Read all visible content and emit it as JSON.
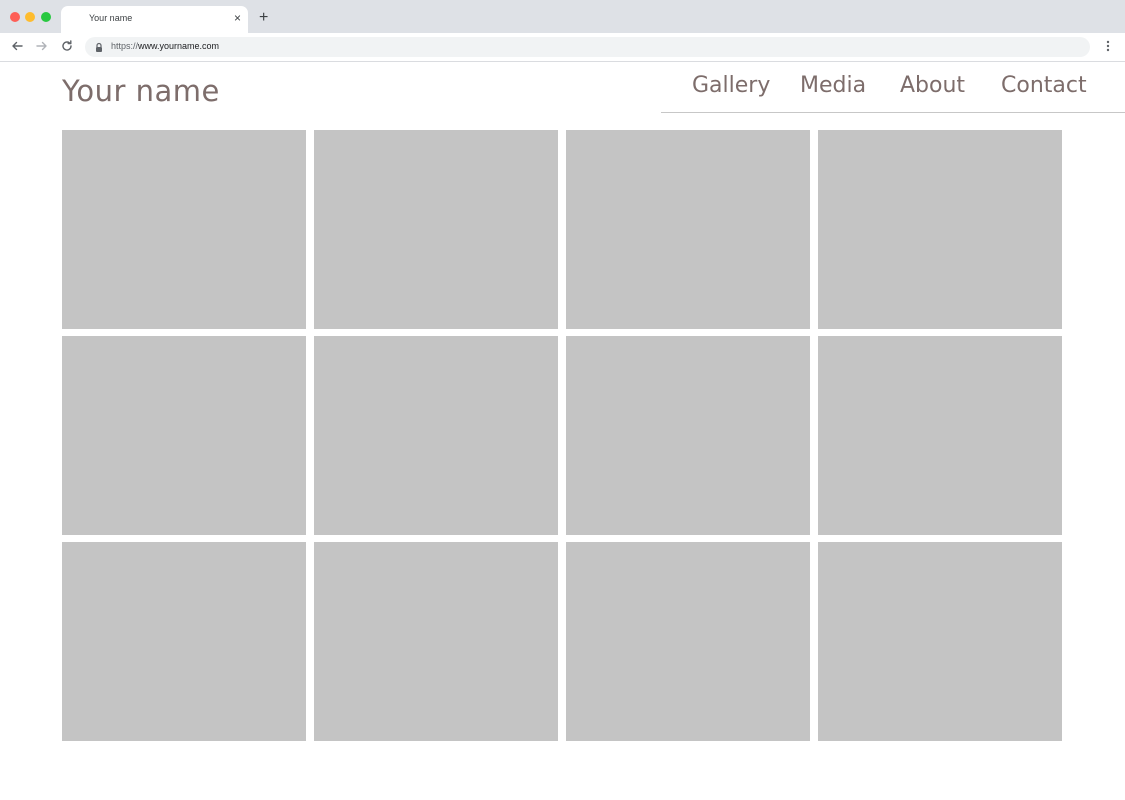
{
  "browser": {
    "tab_title": "Your name",
    "tab_close": "×",
    "new_tab": "+",
    "url_scheme": "https://",
    "url_host": "www.yourname.com"
  },
  "site": {
    "name": "Your name",
    "nav": {
      "gallery": "Gallery",
      "media": "Media",
      "about": "About",
      "contact": "Contact"
    }
  },
  "gallery": {
    "placeholder_color": "#c4c4c4",
    "columns": 4,
    "rows": 3
  },
  "colors": {
    "text_accent": "#7d6d6b",
    "tabstrip": "#dee1e6",
    "omnibox": "#f1f3f4"
  }
}
